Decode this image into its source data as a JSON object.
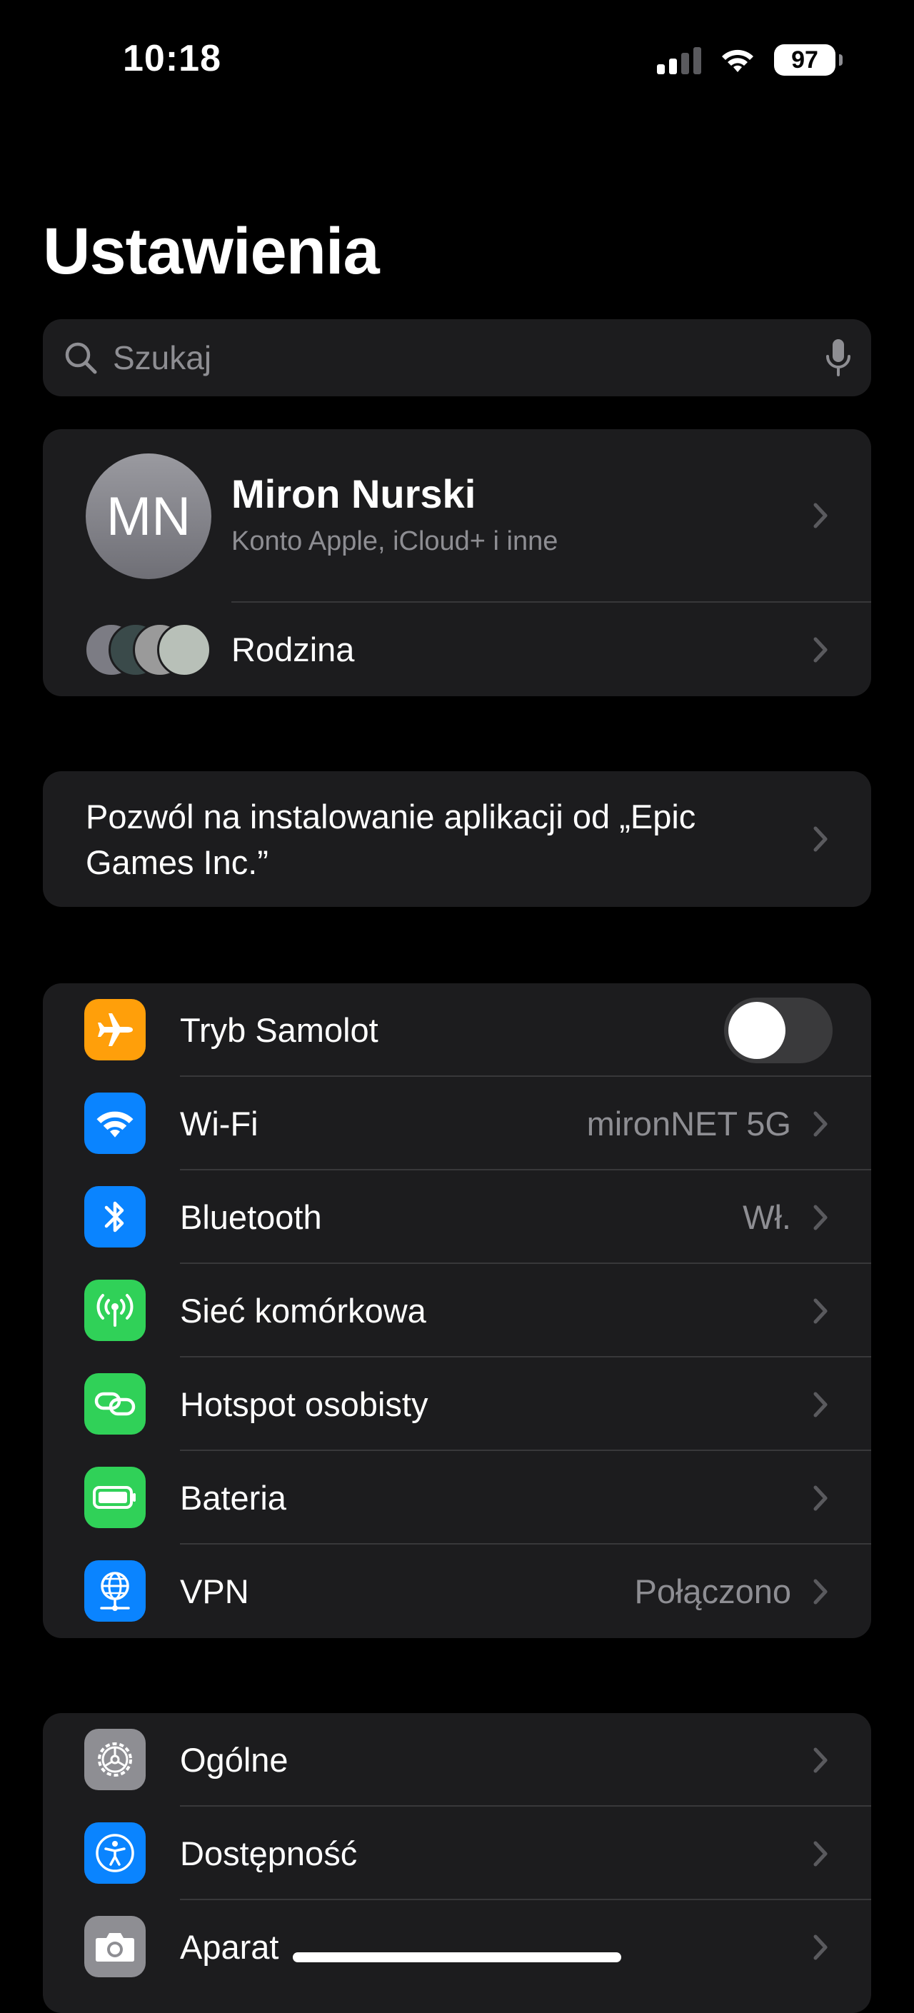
{
  "status_bar": {
    "time": "10:18",
    "battery_level": "97"
  },
  "page_title": "Ustawienia",
  "search": {
    "placeholder": "Szukaj"
  },
  "profile": {
    "initials": "MN",
    "name": "Miron Nurski",
    "subtitle": "Konto Apple, iCloud+ i inne",
    "family_label": "Rodzina"
  },
  "epic_prompt": {
    "text": "Pozwól na instalowanie aplikacji od „Epic Games Inc.”"
  },
  "connectivity": [
    {
      "label": "Tryb Samolot",
      "value": "",
      "icon": "airplane-icon",
      "color": "#ff9f0a",
      "toggle": false
    },
    {
      "label": "Wi-Fi",
      "value": "mironNET 5G",
      "icon": "wifi-icon",
      "color": "#0a84ff"
    },
    {
      "label": "Bluetooth",
      "value": "Wł.",
      "icon": "bluetooth-icon",
      "color": "#0a84ff"
    },
    {
      "label": "Sieć komórkowa",
      "value": "",
      "icon": "cellular-antenna-icon",
      "color": "#30d158"
    },
    {
      "label": "Hotspot osobisty",
      "value": "",
      "icon": "hotspot-chain-icon",
      "color": "#30d158"
    },
    {
      "label": "Bateria",
      "value": "",
      "icon": "battery-icon",
      "color": "#30d158"
    },
    {
      "label": "VPN",
      "value": "Połączono",
      "icon": "vpn-globe-icon",
      "color": "#0a84ff"
    }
  ],
  "general": [
    {
      "label": "Ogólne",
      "icon": "gear-icon",
      "color": "#8e8e93"
    },
    {
      "label": "Dostępność",
      "icon": "accessibility-icon",
      "color": "#0a84ff"
    },
    {
      "label": "Aparat",
      "icon": "camera-icon",
      "color": "#8e8e93"
    }
  ]
}
